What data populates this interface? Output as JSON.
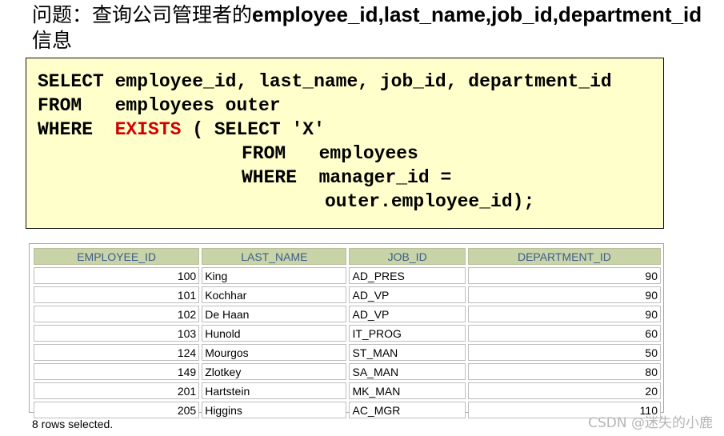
{
  "question": {
    "prefix": "问题：查询公司管理者的",
    "fields": "employee_id,last_name,job_id,department_id",
    "suffix": "信息"
  },
  "code": {
    "line1": {
      "kw": "SELECT",
      "rest": " employee_id, last_name, job_id, department_id"
    },
    "line2": {
      "kw": "FROM  ",
      "rest": " employees outer"
    },
    "line3": {
      "kw": "WHERE ",
      "red": " EXISTS",
      "rest": " ( SELECT 'X'"
    },
    "line4": {
      "kw": "FROM  ",
      "rest": " employees"
    },
    "line5": {
      "kw": "WHERE ",
      "rest": " manager_id ="
    },
    "line6": {
      "rest": "outer.employee_id);"
    },
    "colors": {
      "background": "#ffffcc",
      "keyword_red": "#d00000"
    }
  },
  "table": {
    "headers": [
      "EMPLOYEE_ID",
      "LAST_NAME",
      "JOB_ID",
      "DEPARTMENT_ID"
    ],
    "rows": [
      {
        "employee_id": "100",
        "last_name": "King",
        "job_id": "AD_PRES",
        "department_id": "90"
      },
      {
        "employee_id": "101",
        "last_name": "Kochhar",
        "job_id": "AD_VP",
        "department_id": "90"
      },
      {
        "employee_id": "102",
        "last_name": "De Haan",
        "job_id": "AD_VP",
        "department_id": "90"
      },
      {
        "employee_id": "103",
        "last_name": "Hunold",
        "job_id": "IT_PROG",
        "department_id": "60"
      },
      {
        "employee_id": "124",
        "last_name": "Mourgos",
        "job_id": "ST_MAN",
        "department_id": "50"
      },
      {
        "employee_id": "149",
        "last_name": "Zlotkey",
        "job_id": "SA_MAN",
        "department_id": "80"
      },
      {
        "employee_id": "201",
        "last_name": "Hartstein",
        "job_id": "MK_MAN",
        "department_id": "20"
      },
      {
        "employee_id": "205",
        "last_name": "Higgins",
        "job_id": "AC_MGR",
        "department_id": "110"
      }
    ],
    "colors": {
      "header_bg": "#c9d3a8",
      "header_text": "#3a5e8c"
    }
  },
  "footer": "8 rows selected.",
  "watermark": "CSDN @迷失的小鹿"
}
